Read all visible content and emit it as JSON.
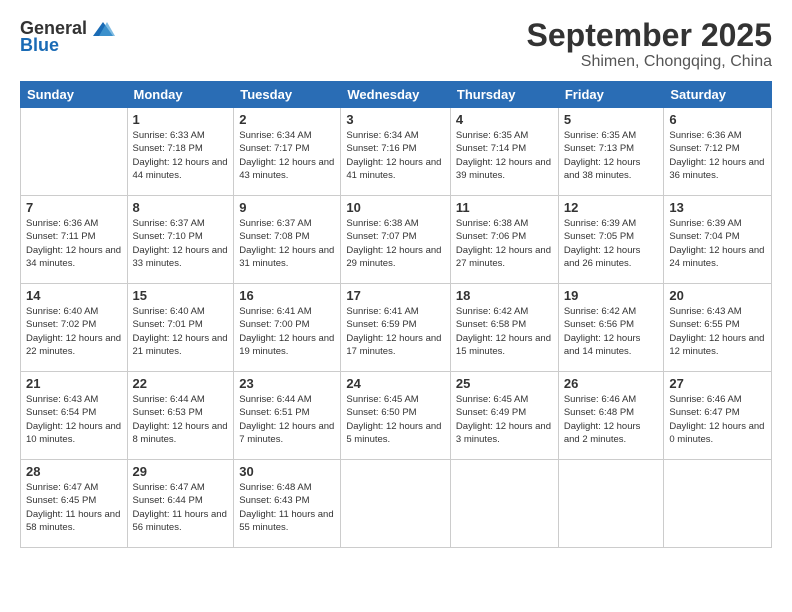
{
  "header": {
    "logo_general": "General",
    "logo_blue": "Blue",
    "month_title": "September 2025",
    "location": "Shimen, Chongqing, China"
  },
  "columns": [
    "Sunday",
    "Monday",
    "Tuesday",
    "Wednesday",
    "Thursday",
    "Friday",
    "Saturday"
  ],
  "weeks": [
    [
      {
        "day": "",
        "info": ""
      },
      {
        "day": "1",
        "info": "Sunrise: 6:33 AM\nSunset: 7:18 PM\nDaylight: 12 hours\nand 44 minutes."
      },
      {
        "day": "2",
        "info": "Sunrise: 6:34 AM\nSunset: 7:17 PM\nDaylight: 12 hours\nand 43 minutes."
      },
      {
        "day": "3",
        "info": "Sunrise: 6:34 AM\nSunset: 7:16 PM\nDaylight: 12 hours\nand 41 minutes."
      },
      {
        "day": "4",
        "info": "Sunrise: 6:35 AM\nSunset: 7:14 PM\nDaylight: 12 hours\nand 39 minutes."
      },
      {
        "day": "5",
        "info": "Sunrise: 6:35 AM\nSunset: 7:13 PM\nDaylight: 12 hours\nand 38 minutes."
      },
      {
        "day": "6",
        "info": "Sunrise: 6:36 AM\nSunset: 7:12 PM\nDaylight: 12 hours\nand 36 minutes."
      }
    ],
    [
      {
        "day": "7",
        "info": "Sunrise: 6:36 AM\nSunset: 7:11 PM\nDaylight: 12 hours\nand 34 minutes."
      },
      {
        "day": "8",
        "info": "Sunrise: 6:37 AM\nSunset: 7:10 PM\nDaylight: 12 hours\nand 33 minutes."
      },
      {
        "day": "9",
        "info": "Sunrise: 6:37 AM\nSunset: 7:08 PM\nDaylight: 12 hours\nand 31 minutes."
      },
      {
        "day": "10",
        "info": "Sunrise: 6:38 AM\nSunset: 7:07 PM\nDaylight: 12 hours\nand 29 minutes."
      },
      {
        "day": "11",
        "info": "Sunrise: 6:38 AM\nSunset: 7:06 PM\nDaylight: 12 hours\nand 27 minutes."
      },
      {
        "day": "12",
        "info": "Sunrise: 6:39 AM\nSunset: 7:05 PM\nDaylight: 12 hours\nand 26 minutes."
      },
      {
        "day": "13",
        "info": "Sunrise: 6:39 AM\nSunset: 7:04 PM\nDaylight: 12 hours\nand 24 minutes."
      }
    ],
    [
      {
        "day": "14",
        "info": "Sunrise: 6:40 AM\nSunset: 7:02 PM\nDaylight: 12 hours\nand 22 minutes."
      },
      {
        "day": "15",
        "info": "Sunrise: 6:40 AM\nSunset: 7:01 PM\nDaylight: 12 hours\nand 21 minutes."
      },
      {
        "day": "16",
        "info": "Sunrise: 6:41 AM\nSunset: 7:00 PM\nDaylight: 12 hours\nand 19 minutes."
      },
      {
        "day": "17",
        "info": "Sunrise: 6:41 AM\nSunset: 6:59 PM\nDaylight: 12 hours\nand 17 minutes."
      },
      {
        "day": "18",
        "info": "Sunrise: 6:42 AM\nSunset: 6:58 PM\nDaylight: 12 hours\nand 15 minutes."
      },
      {
        "day": "19",
        "info": "Sunrise: 6:42 AM\nSunset: 6:56 PM\nDaylight: 12 hours\nand 14 minutes."
      },
      {
        "day": "20",
        "info": "Sunrise: 6:43 AM\nSunset: 6:55 PM\nDaylight: 12 hours\nand 12 minutes."
      }
    ],
    [
      {
        "day": "21",
        "info": "Sunrise: 6:43 AM\nSunset: 6:54 PM\nDaylight: 12 hours\nand 10 minutes."
      },
      {
        "day": "22",
        "info": "Sunrise: 6:44 AM\nSunset: 6:53 PM\nDaylight: 12 hours\nand 8 minutes."
      },
      {
        "day": "23",
        "info": "Sunrise: 6:44 AM\nSunset: 6:51 PM\nDaylight: 12 hours\nand 7 minutes."
      },
      {
        "day": "24",
        "info": "Sunrise: 6:45 AM\nSunset: 6:50 PM\nDaylight: 12 hours\nand 5 minutes."
      },
      {
        "day": "25",
        "info": "Sunrise: 6:45 AM\nSunset: 6:49 PM\nDaylight: 12 hours\nand 3 minutes."
      },
      {
        "day": "26",
        "info": "Sunrise: 6:46 AM\nSunset: 6:48 PM\nDaylight: 12 hours\nand 2 minutes."
      },
      {
        "day": "27",
        "info": "Sunrise: 6:46 AM\nSunset: 6:47 PM\nDaylight: 12 hours\nand 0 minutes."
      }
    ],
    [
      {
        "day": "28",
        "info": "Sunrise: 6:47 AM\nSunset: 6:45 PM\nDaylight: 11 hours\nand 58 minutes."
      },
      {
        "day": "29",
        "info": "Sunrise: 6:47 AM\nSunset: 6:44 PM\nDaylight: 11 hours\nand 56 minutes."
      },
      {
        "day": "30",
        "info": "Sunrise: 6:48 AM\nSunset: 6:43 PM\nDaylight: 11 hours\nand 55 minutes."
      },
      {
        "day": "",
        "info": ""
      },
      {
        "day": "",
        "info": ""
      },
      {
        "day": "",
        "info": ""
      },
      {
        "day": "",
        "info": ""
      }
    ]
  ]
}
